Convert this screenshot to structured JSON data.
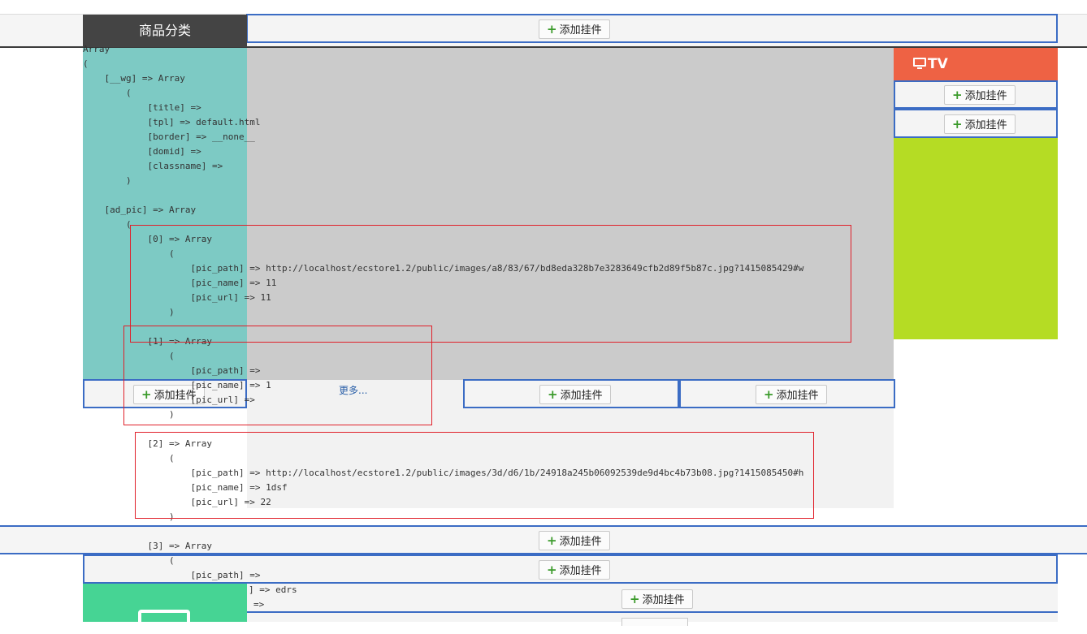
{
  "category_header": "商品分类",
  "tv_header": "TV",
  "more_link": "更多...",
  "add_widget_label": "添加挂件",
  "add_icon": "+",
  "dump_text": "Array\n(\n    [__wg] => Array\n        (\n            [title] =>\n            [tpl] => default.html\n            [border] => __none__\n            [domid] =>\n            [classname] =>\n        )\n\n    [ad_pic] => Array\n        (\n            [0] => Array\n                (\n                    [pic_path] => http://localhost/ecstore1.2/public/images/a8/83/67/bd8eda328b7e3283649cfb2d89f5b87c.jpg?1415085429#w\n                    [pic_name] => 11\n                    [pic_url] => 11\n                )\n\n            [1] => Array\n                (\n                    [pic_path] =>\n                    [pic_name] => 1\n                    [pic_url] =>\n                )\n\n            [2] => Array\n                (\n                    [pic_path] => http://localhost/ecstore1.2/public/images/3d/d6/1b/24918a245b06092539de9d4bc4b73b08.jpg?1415085450#h\n                    [pic_name] => 1dsf\n                    [pic_url] => 22\n                )\n\n            [3] => Array\n                (\n                    [pic_path] =>",
  "dump_tail_1": "] => edrs",
  "dump_tail_2": "=>",
  "colors": {
    "slot_border": "#3b6cc4",
    "category_bg": "#444444",
    "teal_panel": "#7dcac4",
    "tv_header": "#ee6244",
    "lime_panel": "#b5dc24",
    "green_panel": "#46d494",
    "red_outline": "#e0202a"
  },
  "icons": {
    "plus": "plus-icon",
    "tv": "monitor-icon"
  }
}
